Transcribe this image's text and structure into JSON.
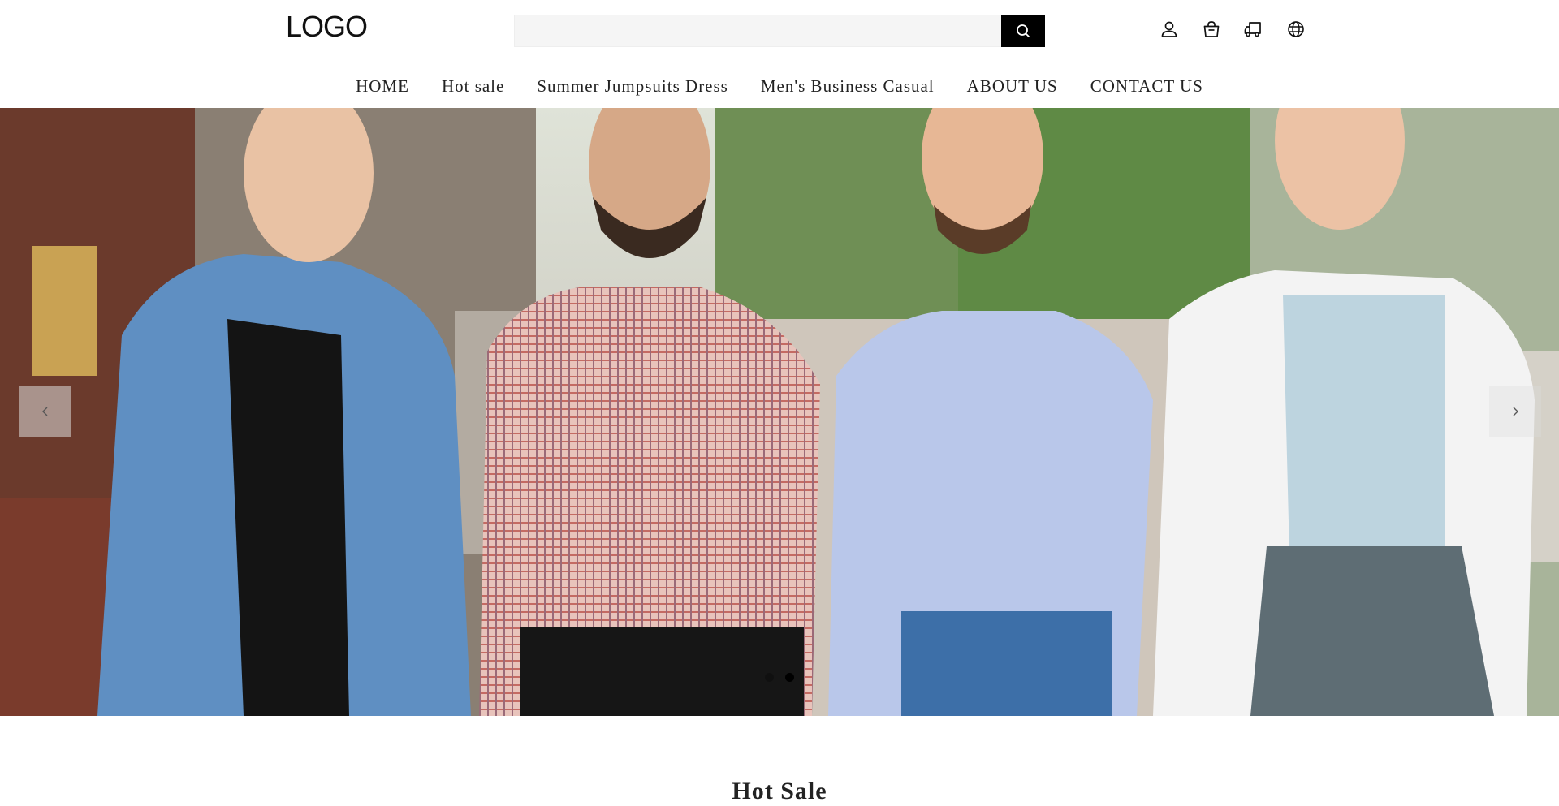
{
  "header": {
    "logo": "LOGO",
    "search": {
      "placeholder": "",
      "value": "",
      "button_icon": "search-icon"
    },
    "icons": [
      "user-icon",
      "shopping-bag-icon",
      "order-tracking-icon",
      "globe-icon"
    ]
  },
  "nav": {
    "items": [
      {
        "label": "HOME"
      },
      {
        "label": "Hot sale"
      },
      {
        "label": "Summer Jumpsuits Dress"
      },
      {
        "label": "Men's Business Casual"
      },
      {
        "label": "ABOUT US"
      },
      {
        "label": "CONTACT US"
      }
    ]
  },
  "banner": {
    "image": "four-men-walking-street-photo",
    "prev_icon": "chevron-left-icon",
    "next_icon": "chevron-right-icon",
    "slides_total": 2,
    "active_slide": 2
  },
  "sections": {
    "hot_sale_title": "Hot Sale"
  },
  "colors": {
    "accent": "#000000",
    "search_bg": "#f5f5f5",
    "text": "#222222"
  }
}
